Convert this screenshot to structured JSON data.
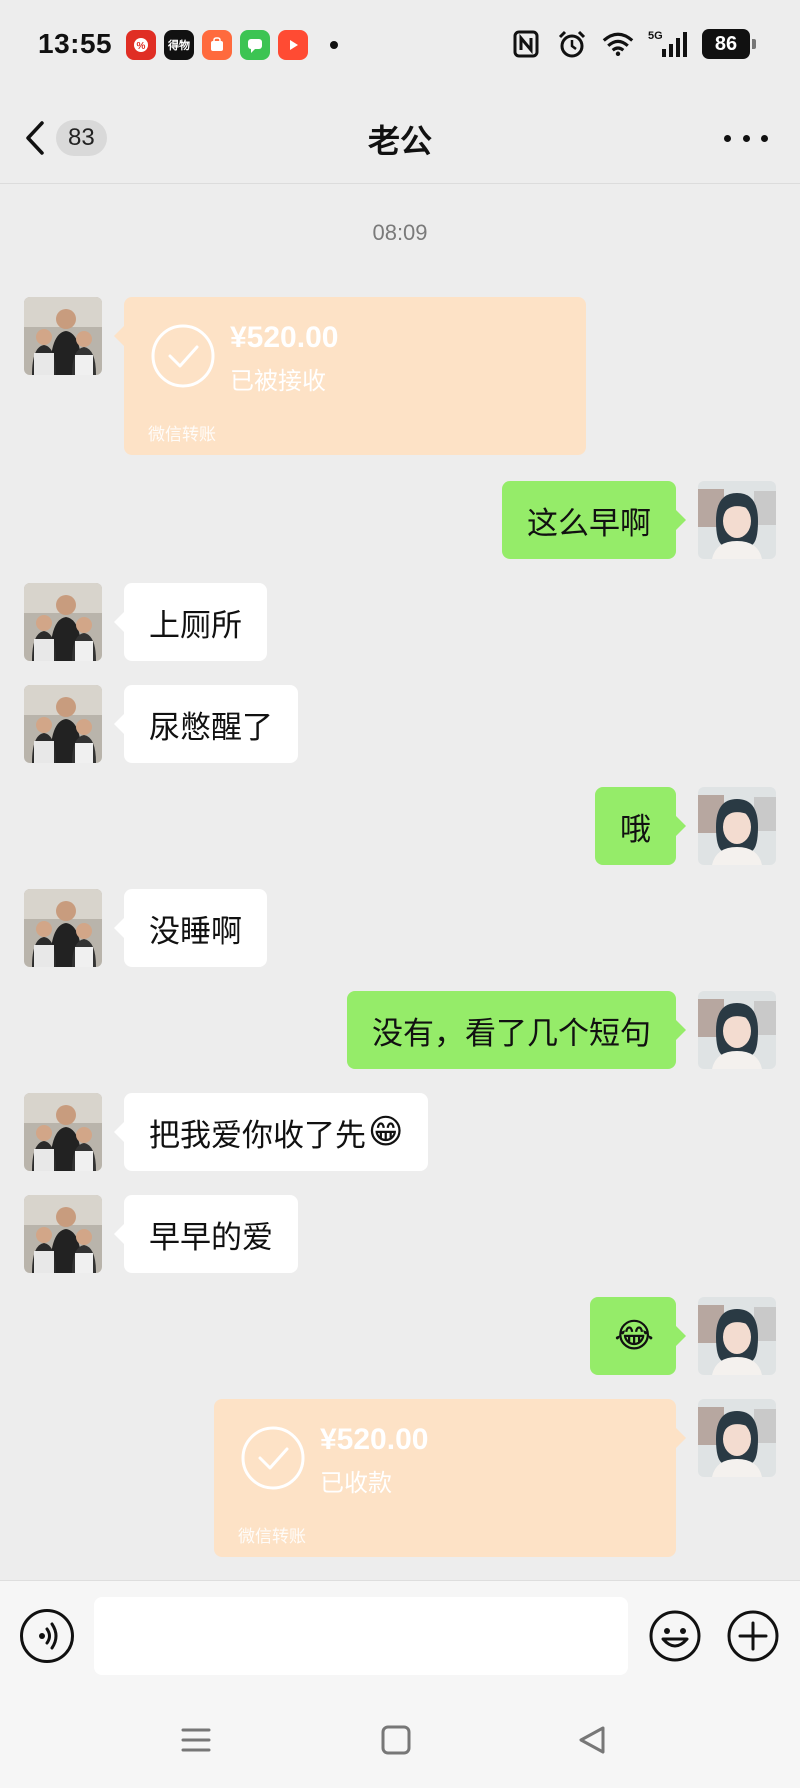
{
  "status_bar": {
    "time": "13:55",
    "app_icons": [
      {
        "icon": "pinduoduo-app-icon",
        "label": "",
        "color": "#e02e24"
      },
      {
        "icon": "dewu-app-icon",
        "label": "得物",
        "color": "#111111"
      },
      {
        "icon": "shop-app-icon",
        "label": "",
        "color": "#ff6a3d"
      },
      {
        "icon": "messages-app-icon",
        "label": "",
        "color": "#3cc453"
      },
      {
        "icon": "video-app-icon",
        "label": "",
        "color": "#ff4b33"
      }
    ],
    "battery": "86",
    "network": "5G"
  },
  "header": {
    "unread_count": "83",
    "title": "老公"
  },
  "timestamp": "08:09",
  "colors": {
    "outgoing_bubble": "#95ec69",
    "incoming_bubble": "#ffffff",
    "transfer_bubble": "#fde2c6",
    "background": "#ededed"
  },
  "messages": [
    {
      "type": "transfer",
      "side": "incoming",
      "amount": "¥520.00",
      "status": "已被接收",
      "footer": "微信转账"
    },
    {
      "type": "text",
      "side": "outgoing",
      "text": "这么早啊"
    },
    {
      "type": "text",
      "side": "incoming",
      "text": "上厕所"
    },
    {
      "type": "text",
      "side": "incoming",
      "text": "尿憋醒了"
    },
    {
      "type": "text",
      "side": "outgoing",
      "text": "哦"
    },
    {
      "type": "text",
      "side": "incoming",
      "text": "没睡啊"
    },
    {
      "type": "text",
      "side": "outgoing",
      "text": "没有，看了几个短句"
    },
    {
      "type": "text",
      "side": "incoming",
      "text": "把我爱你收了先",
      "emoji": "😁"
    },
    {
      "type": "text",
      "side": "incoming",
      "text": "早早的爱"
    },
    {
      "type": "text",
      "side": "outgoing",
      "text": "",
      "emoji": "😂"
    },
    {
      "type": "transfer",
      "side": "outgoing",
      "amount": "¥520.00",
      "status": "已收款",
      "footer": "微信转账"
    }
  ],
  "input_bar": {
    "placeholder": ""
  }
}
